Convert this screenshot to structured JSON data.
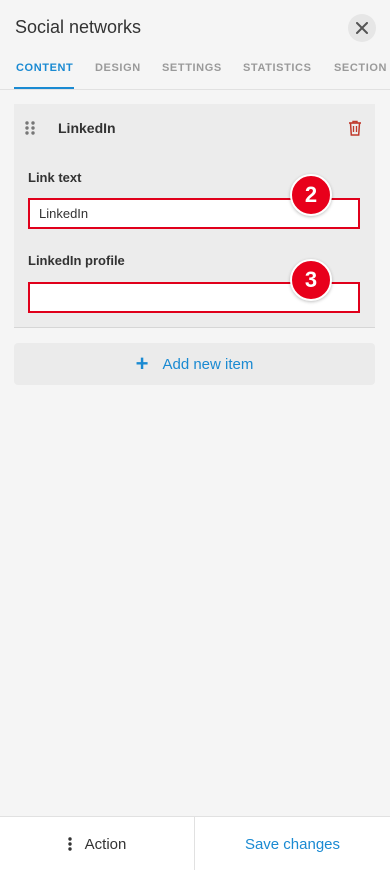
{
  "header": {
    "title": "Social networks"
  },
  "tabs": [
    {
      "label": "CONTENT",
      "active": true
    },
    {
      "label": "DESIGN"
    },
    {
      "label": "SETTINGS"
    },
    {
      "label": "STATISTICS"
    },
    {
      "label": "SECTION"
    }
  ],
  "item": {
    "name": "LinkedIn",
    "fields": [
      {
        "label": "Link text",
        "value": "LinkedIn",
        "badge": "2"
      },
      {
        "label": "LinkedIn profile",
        "value": "",
        "badge": "3"
      }
    ]
  },
  "add_item": {
    "label": "Add new item"
  },
  "footer": {
    "action_label": "Action",
    "save_label": "Save changes"
  },
  "colors": {
    "accent": "#1a8ad2",
    "highlight": "#e8001b",
    "delete": "#c0392b"
  },
  "icons": {
    "close": "close-icon",
    "drag": "drag-handle-icon",
    "delete": "trash-icon",
    "add": "plus-icon",
    "more": "kebab-icon"
  }
}
